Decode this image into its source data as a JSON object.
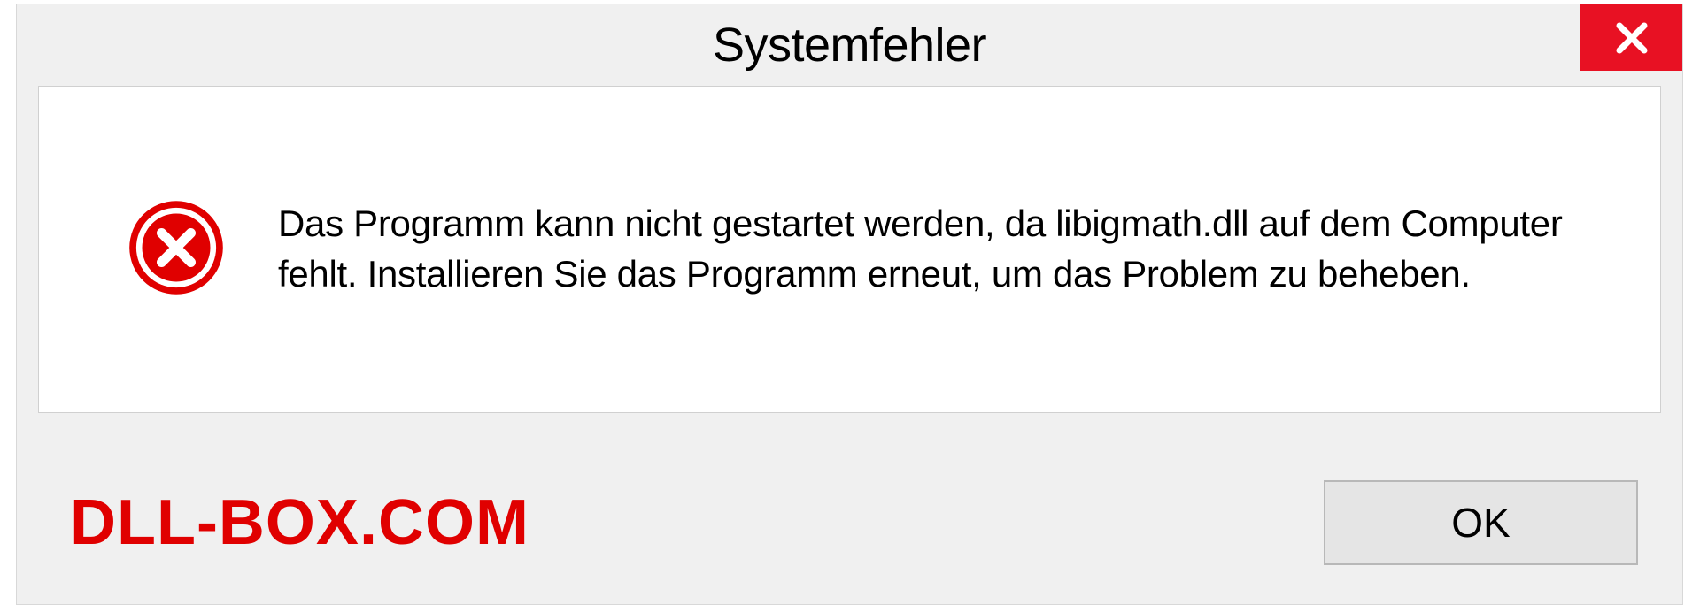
{
  "dialog": {
    "title": "Systemfehler",
    "message": "Das Programm kann nicht gestartet werden, da libigmath.dll auf dem Computer fehlt. Installieren Sie das Programm erneut, um das Problem zu beheben.",
    "ok_label": "OK"
  },
  "watermark": "DLL-BOX.COM"
}
